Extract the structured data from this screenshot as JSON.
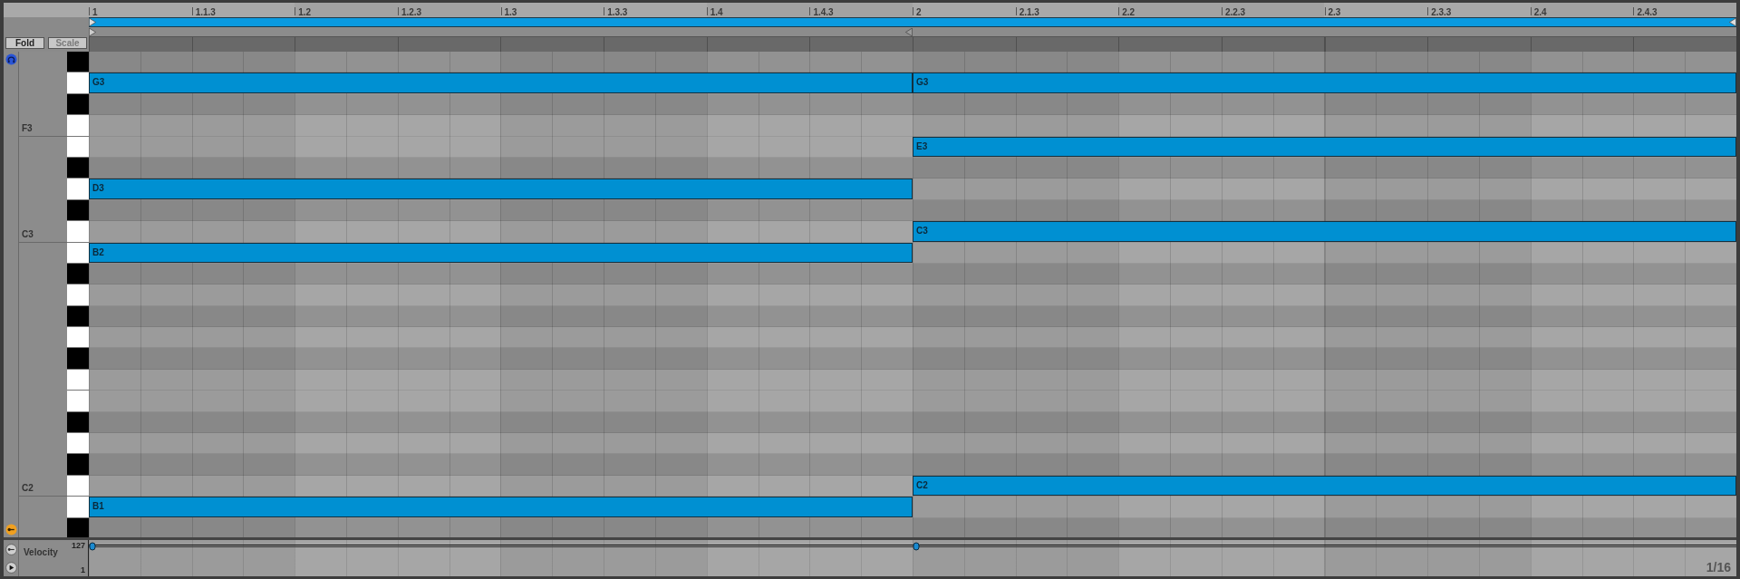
{
  "ruler": {
    "labels": [
      "1",
      "1.1.3",
      "1.2",
      "1.2.3",
      "1.3",
      "1.3.3",
      "1.4",
      "1.4.3",
      "2",
      "2.1.3",
      "2.2",
      "2.2.3",
      "2.3",
      "2.3.3",
      "2.4",
      "2.4.3"
    ]
  },
  "buttons": [
    {
      "label": "Fold",
      "disabled": false
    },
    {
      "label": "Scale",
      "disabled": true
    }
  ],
  "rows": [
    {
      "kind": "sharp",
      "notes": [
        {
          "kind": "empty"
        },
        {
          "kind": "empty"
        }
      ]
    },
    {
      "kind": "natural",
      "notes": [
        {
          "kind": "note",
          "label": "G3"
        },
        {
          "kind": "note",
          "label": "G3"
        }
      ]
    },
    {
      "kind": "sharp",
      "notes": [
        {
          "kind": "empty"
        },
        {
          "kind": "empty"
        }
      ]
    },
    {
      "kind": "natural",
      "octave_label": "F3",
      "notes": [
        {
          "kind": "empty"
        },
        {
          "kind": "empty"
        }
      ]
    },
    {
      "kind": "natural",
      "notes": [
        {
          "kind": "empty"
        },
        {
          "kind": "note",
          "label": "E3"
        }
      ]
    },
    {
      "kind": "sharp",
      "notes": [
        {
          "kind": "empty"
        },
        {
          "kind": "empty"
        }
      ]
    },
    {
      "kind": "natural",
      "notes": [
        {
          "kind": "note",
          "label": "D3"
        },
        {
          "kind": "empty"
        }
      ]
    },
    {
      "kind": "sharp",
      "notes": [
        {
          "kind": "empty"
        },
        {
          "kind": "empty"
        }
      ]
    },
    {
      "kind": "natural",
      "octave_label": "C3",
      "notes": [
        {
          "kind": "empty"
        },
        {
          "kind": "note",
          "label": "C3"
        }
      ]
    },
    {
      "kind": "natural",
      "notes": [
        {
          "kind": "note",
          "label": "B2"
        },
        {
          "kind": "empty"
        }
      ]
    },
    {
      "kind": "sharp",
      "notes": [
        {
          "kind": "empty"
        },
        {
          "kind": "empty"
        }
      ]
    },
    {
      "kind": "natural",
      "notes": [
        {
          "kind": "empty"
        },
        {
          "kind": "empty"
        }
      ]
    },
    {
      "kind": "sharp",
      "notes": [
        {
          "kind": "empty"
        },
        {
          "kind": "empty"
        }
      ]
    },
    {
      "kind": "natural",
      "notes": [
        {
          "kind": "empty"
        },
        {
          "kind": "empty"
        }
      ]
    },
    {
      "kind": "sharp",
      "notes": [
        {
          "kind": "empty"
        },
        {
          "kind": "empty"
        }
      ]
    },
    {
      "kind": "natural",
      "notes": [
        {
          "kind": "empty"
        },
        {
          "kind": "empty"
        }
      ]
    },
    {
      "kind": "natural",
      "notes": [
        {
          "kind": "empty"
        },
        {
          "kind": "empty"
        }
      ]
    },
    {
      "kind": "sharp",
      "notes": [
        {
          "kind": "empty"
        },
        {
          "kind": "empty"
        }
      ]
    },
    {
      "kind": "natural",
      "notes": [
        {
          "kind": "empty"
        },
        {
          "kind": "empty"
        }
      ]
    },
    {
      "kind": "sharp",
      "notes": [
        {
          "kind": "empty"
        },
        {
          "kind": "empty"
        }
      ]
    },
    {
      "kind": "natural",
      "octave_label": "C2",
      "notes": [
        {
          "kind": "empty"
        },
        {
          "kind": "note",
          "label": "C2"
        }
      ]
    },
    {
      "kind": "natural",
      "notes": [
        {
          "kind": "note",
          "label": "B1"
        },
        {
          "kind": "empty"
        }
      ]
    },
    {
      "kind": "sharp",
      "notes": [
        {
          "kind": "empty"
        },
        {
          "kind": "empty"
        }
      ]
    }
  ],
  "velocity": {
    "label": "Velocity",
    "max": "127",
    "min": "1"
  },
  "grid": {
    "quantize": "1/16"
  }
}
